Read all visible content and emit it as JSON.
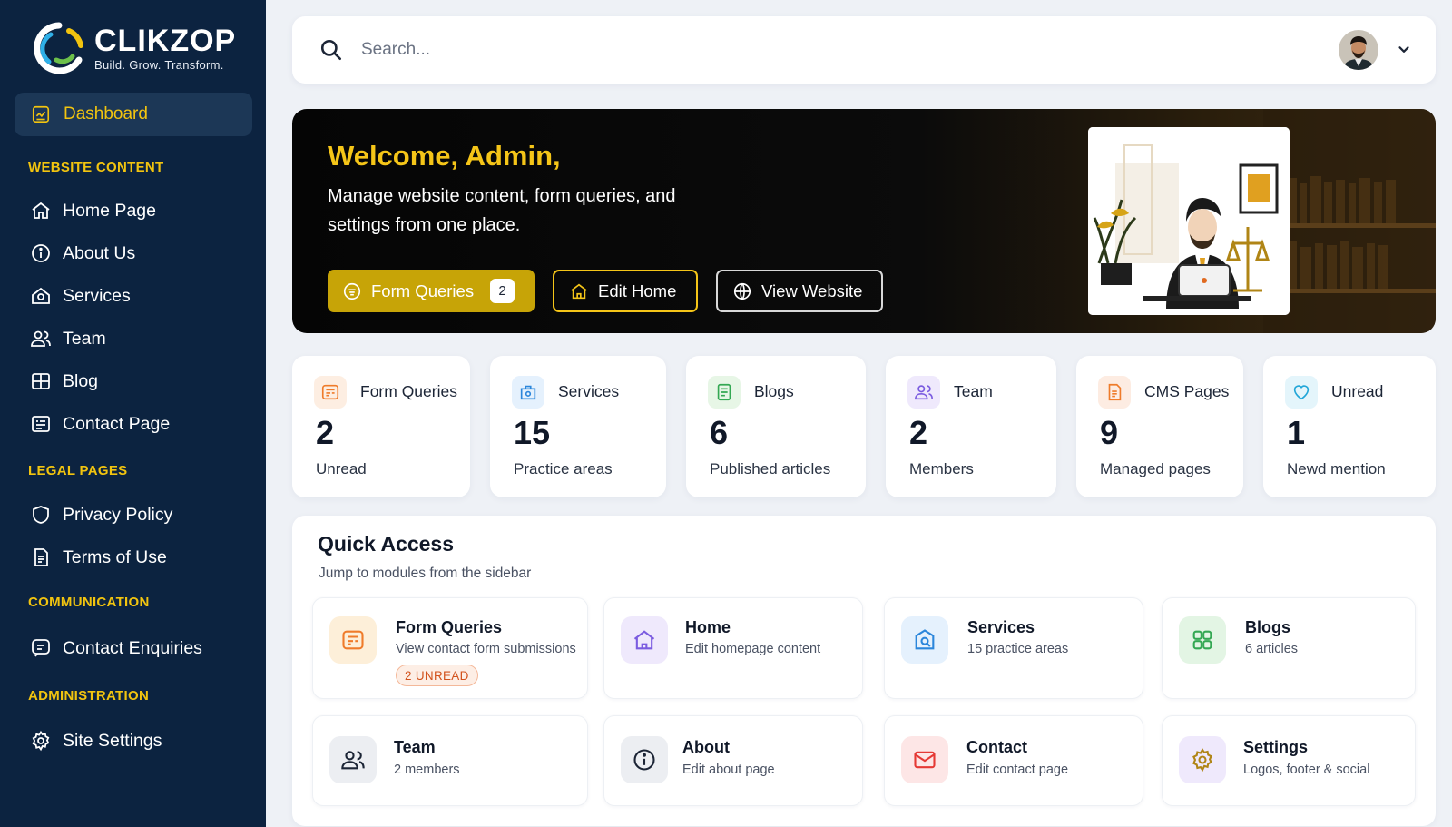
{
  "brand": {
    "name": "CLIKZOP",
    "tagline": "Build. Grow. Transform."
  },
  "sidebar": {
    "dashboard": "Dashboard",
    "sections": [
      {
        "heading": "WEBSITE CONTENT",
        "items": [
          "Home Page",
          "About Us",
          "Services",
          "Team",
          "Blog",
          "Contact Page"
        ]
      },
      {
        "heading": "LEGAL PAGES",
        "items": [
          "Privacy Policy",
          "Terms of Use"
        ]
      },
      {
        "heading": "COMMUNICATION",
        "items": [
          "Contact Enquiries"
        ]
      },
      {
        "heading": "ADMINISTRATION",
        "items": [
          "Site Settings"
        ]
      }
    ]
  },
  "search": {
    "placeholder": "Search..."
  },
  "hero": {
    "title": "Welcome, Admin,",
    "subtitle": "Manage website content, form queries, and settings from one place.",
    "btn_form_queries": "Form Queries",
    "btn_form_queries_count": "2",
    "btn_edit_home": "Edit Home",
    "btn_view_website": "View Website"
  },
  "stats": [
    {
      "label": "Form Queries",
      "value": "2",
      "caption": "Unread"
    },
    {
      "label": "Services",
      "value": "15",
      "caption": "Practice areas"
    },
    {
      "label": "Blogs",
      "value": "6",
      "caption": "Published articles"
    },
    {
      "label": "Team",
      "value": "2",
      "caption": "Members"
    },
    {
      "label": "CMS Pages",
      "value": "9",
      "caption": "Managed pages"
    },
    {
      "label": "Unread",
      "value": "1",
      "caption": "Newd mention"
    }
  ],
  "quick_access": {
    "title": "Quick Access",
    "subtitle": "Jump to modules from the sidebar",
    "cards": [
      {
        "title": "Form Queries",
        "desc": "View contact form submissions",
        "badge": "2 UNREAD"
      },
      {
        "title": "Home",
        "desc": "Edit homepage content"
      },
      {
        "title": "Services",
        "desc": "15 practice areas"
      },
      {
        "title": "Blogs",
        "desc": "6 articles"
      },
      {
        "title": "Team",
        "desc": "2 members"
      },
      {
        "title": "About",
        "desc": "Edit about page"
      },
      {
        "title": "Contact",
        "desc": "Edit contact page"
      },
      {
        "title": "Settings",
        "desc": "Logos, footer & social"
      }
    ]
  },
  "colors": {
    "sidebar": "#0c2340",
    "accent": "#f2c40f",
    "button_gold": "#c7a407"
  }
}
